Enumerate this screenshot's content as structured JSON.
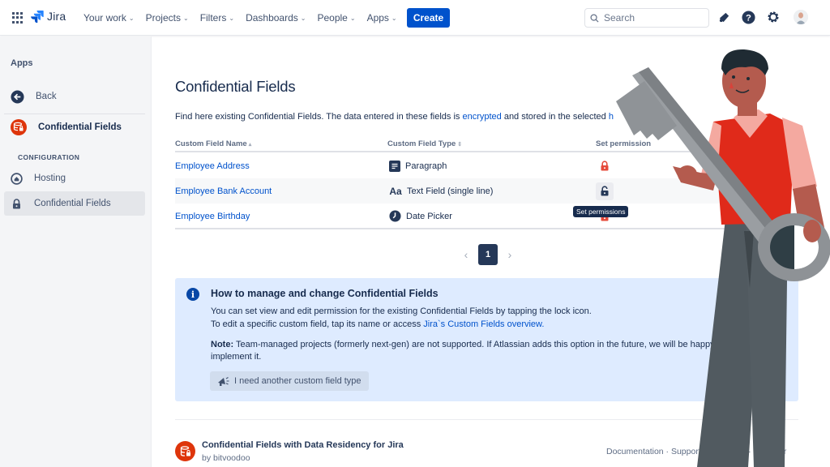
{
  "topnav": {
    "app_name": "Jira",
    "items": [
      {
        "label": "Your work"
      },
      {
        "label": "Projects"
      },
      {
        "label": "Filters"
      },
      {
        "label": "Dashboards"
      },
      {
        "label": "People"
      },
      {
        "label": "Apps"
      }
    ],
    "create_label": "Create",
    "search_placeholder": "Search",
    "icons": [
      "notifications-icon",
      "help-icon",
      "settings-icon",
      "avatar"
    ]
  },
  "sidebar": {
    "heading": "Apps",
    "back_label": "Back",
    "app_label": "Confidential Fields",
    "section_label": "CONFIGURATION",
    "items": [
      {
        "label": "Hosting",
        "icon": "home-icon",
        "active": false
      },
      {
        "label": "Confidential Fields",
        "icon": "lock-icon",
        "active": true
      }
    ]
  },
  "main": {
    "title": "Confidential Fields",
    "intro_before": "Find here existing Confidential Fields. The data entered in these fields is ",
    "intro_link": "encrypted",
    "intro_after": " and stored in the selected ",
    "intro_tail": "h",
    "table": {
      "columns": [
        {
          "label": "Custom Field Name",
          "sort": "▴"
        },
        {
          "label": "Custom Field Type",
          "sort": "⇕"
        },
        {
          "label": "Set permission"
        }
      ],
      "rows": [
        {
          "name": "Employee Address",
          "type": "Paragraph",
          "type_icon": "paragraph-icon",
          "lock": "locked"
        },
        {
          "name": "Employee Bank Account",
          "type": "Text Field (single line)",
          "type_icon": "text-field-icon",
          "type_icon_text": "Aa",
          "lock": "unlocked"
        },
        {
          "name": "Employee Birthday",
          "type": "Date Picker",
          "type_icon": "clock-icon",
          "lock": "locked"
        }
      ],
      "tooltip": "Set permissions"
    },
    "pagination": {
      "current": "1",
      "prev": "‹",
      "next": "›"
    },
    "info": {
      "title": "How to manage and change Confidential Fields",
      "line1": "You can set view and edit permission for the existing Confidential Fields by tapping the lock icon.",
      "line2_before": "To edit a specific custom field, tap its name or access ",
      "line2_link": "Jira`s Custom Fields overview.",
      "note_label": "Note:",
      "note_text": " Team-managed projects (formerly next-gen) are not supported. If Atlassian adds this option in the future, we will be happy to",
      "note_text2": "implement it.",
      "button_label": "I need another custom field type"
    },
    "footer": {
      "title": "Confidential Fields with Data Residency for Jira",
      "by": "by bitvoodoo",
      "links": "Documentation · Support · Feedback · Discover"
    }
  },
  "colors": {
    "brand": "#0052cc",
    "lock_red": "#e5493a",
    "info_bg": "#deebff",
    "nav_dark": "#253858"
  }
}
